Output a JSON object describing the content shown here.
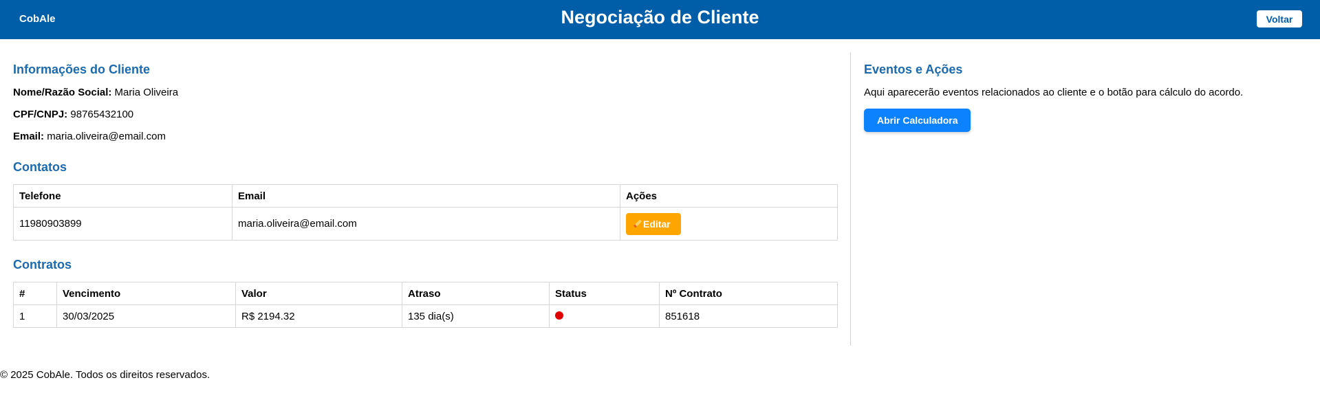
{
  "header": {
    "brand": "CobAle",
    "title": "Negociação de Cliente",
    "back_label": "Voltar"
  },
  "client_info": {
    "title": "Informações do Cliente",
    "name_label": "Nome/Razão Social:",
    "name": "Maria Oliveira",
    "doc_label": "CPF/CNPJ:",
    "doc": "98765432100",
    "email_label": "Email:",
    "email": "maria.oliveira@email.com"
  },
  "contacts": {
    "title": "Contatos",
    "columns": [
      "Telefone",
      "Email",
      "Ações"
    ],
    "rows": [
      {
        "phone": "11980903899",
        "email": "maria.oliveira@email.com",
        "action_label": "Editar",
        "action_icon": "pencil-icon"
      }
    ]
  },
  "contracts": {
    "title": "Contratos",
    "columns": [
      "#",
      "Vencimento",
      "Valor",
      "Atraso",
      "Status",
      "Nº Contrato"
    ],
    "rows": [
      {
        "index": "1",
        "due_date": "30/03/2025",
        "value": "R$ 2194.32",
        "delay": "135 dia(s)",
        "status_color": "#e00000",
        "contract_no": "851618"
      }
    ]
  },
  "events": {
    "title": "Eventos e Ações",
    "description": "Aqui aparecerão eventos relacionados ao cliente e o botão para cálculo do acordo.",
    "calc_button_label": "Abrir Calculadora"
  },
  "footer": {
    "text": "© 2025 CobAle. Todos os direitos reservados."
  },
  "colors": {
    "header_bg": "#005ea8",
    "section_title": "#1b6aad",
    "edit_button": "#ffa500",
    "calc_button": "#0d82ff"
  }
}
